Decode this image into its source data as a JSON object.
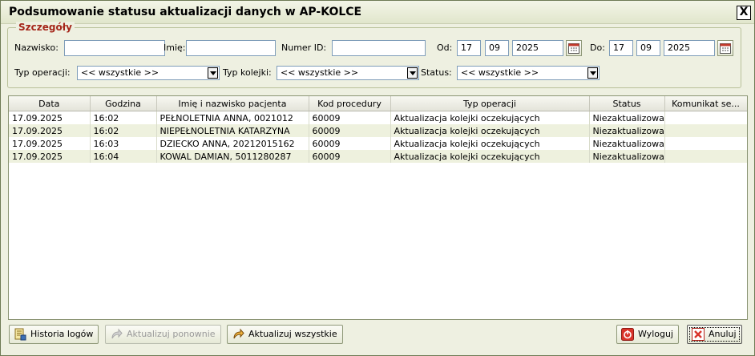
{
  "window": {
    "title": "Podsumowanie statusu aktualizacji danych w AP-KOLCE",
    "close_label": "X"
  },
  "details": {
    "legend": "Szczegóły",
    "nazwisko_label": "Nazwisko:",
    "nazwisko_value": "",
    "imie_label": "Imię:",
    "imie_value": "",
    "numer_id_label": "Numer ID:",
    "numer_id_value": "",
    "od_label": "Od:",
    "od_day": "17",
    "od_month": "09",
    "od_year": "2025",
    "do_label": "Do:",
    "do_day": "17",
    "do_month": "09",
    "do_year": "2025",
    "typ_operacji_label": "Typ operacji:",
    "typ_operacji_value": "<< wszystkie >>",
    "typ_kolejki_label": "Typ kolejki:",
    "typ_kolejki_value": "<< wszystkie >>",
    "status_label": "Status:",
    "status_value": "<< wszystkie >>"
  },
  "table": {
    "columns": [
      "Data",
      "Godzina",
      "Imię i nazwisko pacjenta",
      "Kod procedury",
      "Typ operacji",
      "Status",
      "Komunikat se..."
    ],
    "rows": [
      [
        "17.09.2025",
        "16:02",
        "PEŁNOLETNIA ANNA, 0021012",
        "60009",
        "Aktualizacja kolejki oczekujących",
        "Niezaktualizowa",
        ""
      ],
      [
        "17.09.2025",
        "16:02",
        "NIEPEŁNOLETNIA KATARZYNA",
        "60009",
        "Aktualizacja kolejki oczekujących",
        "Niezaktualizowa",
        ""
      ],
      [
        "17.09.2025",
        "16:03",
        "DZIECKO ANNA, 20212015162",
        "60009",
        "Aktualizacja kolejki oczekujących",
        "Niezaktualizowa",
        ""
      ],
      [
        "17.09.2025",
        "16:04",
        "KOWAL DAMIAN, 5011280287",
        "60009",
        "Aktualizacja kolejki oczekujących",
        "Niezaktualizowa",
        ""
      ]
    ]
  },
  "buttons": {
    "historia": "Historia logów",
    "aktualizuj_ponownie": "Aktualizuj ponownie",
    "aktualizuj_wszystkie": "Aktualizuj wszystkie",
    "wyloguj": "Wyloguj",
    "anuluj": "Anuluj"
  },
  "icons": {
    "calendar": "calendar-icon",
    "history": "log-history-icon",
    "refresh": "refresh-arrow-icon",
    "logout": "power-icon",
    "cancel": "cancel-x-icon"
  },
  "colors": {
    "accent": "#a5261a",
    "row_alt": "#eef1de",
    "window_bg": "#eef0e1"
  }
}
